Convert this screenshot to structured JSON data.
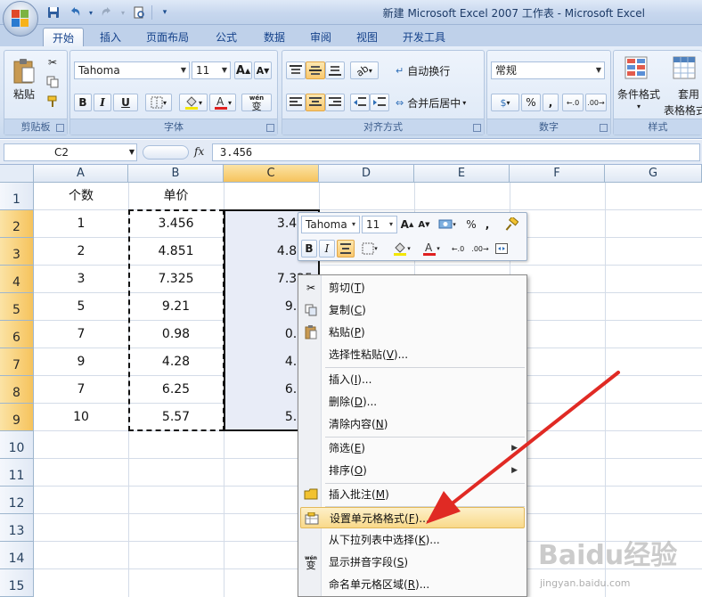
{
  "window": {
    "title": "新建 Microsoft Excel 2007 工作表 - Microsoft Excel"
  },
  "quick_access": {
    "save_icon": "save-icon",
    "undo_icon": "undo-icon",
    "redo_icon": "redo-icon",
    "print_preview_icon": "print-preview-icon"
  },
  "tabs": [
    "开始",
    "插入",
    "页面布局",
    "公式",
    "数据",
    "审阅",
    "视图",
    "开发工具"
  ],
  "active_tab": "开始",
  "ribbon": {
    "clipboard": {
      "label": "剪贴板",
      "paste": "粘贴"
    },
    "font": {
      "label": "字体",
      "font_name": "Tahoma",
      "font_size": "11",
      "bold": "B",
      "italic": "I",
      "underline": "U",
      "grow": "A",
      "shrink": "A",
      "phonetic": "wén"
    },
    "alignment": {
      "label": "对齐方式",
      "wrap_text": "自动换行",
      "merge_center": "合并后居中"
    },
    "number": {
      "label": "数字",
      "format": "常规",
      "percent": "%",
      "comma": ","
    },
    "styles": {
      "label": "样式",
      "conditional": "条件格式",
      "table_fmt_1": "套用",
      "table_fmt_2": "表格格式"
    }
  },
  "formula_bar": {
    "name_box": "C2",
    "fx": "fx",
    "content": "3.456"
  },
  "columns": [
    "A",
    "B",
    "C",
    "D",
    "E",
    "F",
    "G"
  ],
  "rows": [
    "1",
    "2",
    "3",
    "4",
    "5",
    "6",
    "7",
    "8",
    "9",
    "10",
    "11",
    "12",
    "13",
    "14",
    "15"
  ],
  "cells": {
    "A1": "个数",
    "B1": "单价",
    "A": [
      "1",
      "2",
      "3",
      "5",
      "7",
      "9",
      "7",
      "10"
    ],
    "B": [
      "3.456",
      "4.851",
      "7.325",
      "9.21",
      "0.98",
      "4.28",
      "6.25",
      "5.57"
    ],
    "C": [
      "3.456",
      "4.851",
      "7.325",
      "9.21",
      "0.98",
      "4.28",
      "6.25",
      "5.57"
    ]
  },
  "mini_toolbar": {
    "font_name": "Tahoma",
    "font_size": "11",
    "bold": "B",
    "italic": "I",
    "percent": "%",
    "comma": ","
  },
  "context_menu": {
    "cut": {
      "label": "剪切",
      "key": "T"
    },
    "copy": {
      "label": "复制",
      "key": "C"
    },
    "paste": {
      "label": "粘贴",
      "key": "P"
    },
    "paste_special": {
      "label": "选择性粘贴",
      "key": "V",
      "suffix": "..."
    },
    "insert": {
      "label": "插入",
      "key": "I",
      "suffix": "..."
    },
    "delete": {
      "label": "删除",
      "key": "D",
      "suffix": "..."
    },
    "clear": {
      "label": "清除内容",
      "key": "N"
    },
    "filter": {
      "label": "筛选",
      "key": "E"
    },
    "sort": {
      "label": "排序",
      "key": "O"
    },
    "insert_comment": {
      "label": "插入批注",
      "key": "M"
    },
    "format_cells": {
      "label": "设置单元格格式",
      "key": "F",
      "suffix": "..."
    },
    "pick_list": {
      "label": "从下拉列表中选择",
      "key": "K",
      "suffix": "..."
    },
    "phonetic": {
      "label": "显示拼音字段",
      "key": "S"
    },
    "name_range": {
      "label": "命名单元格区域",
      "key": "R",
      "suffix": "..."
    }
  },
  "watermark": {
    "brand": "Baidu经验",
    "url": "jingyan.baidu.com"
  },
  "colors": {
    "selection_fill": "#e8ecf7",
    "header_selected": "#f6c35c",
    "menu_highlight": "#f9d98a",
    "arrow": "#e02a24"
  }
}
